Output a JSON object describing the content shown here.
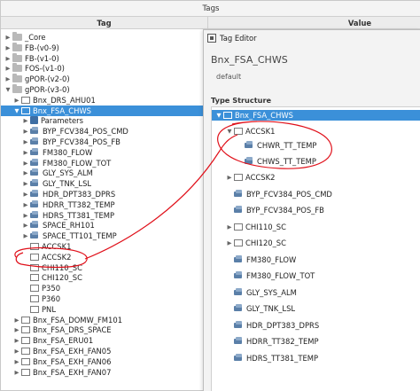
{
  "header": {
    "title": "Tags"
  },
  "columns": {
    "tag": "Tag",
    "value": "Value"
  },
  "tree": [
    {
      "label": "_Core",
      "icon": "folder",
      "arrow": "▶"
    },
    {
      "label": "FB-(v0-9)",
      "icon": "folder",
      "arrow": "▶"
    },
    {
      "label": "FB-(v1-0)",
      "icon": "folder",
      "arrow": "▶"
    },
    {
      "label": "FOS-(v1-0)",
      "icon": "folder",
      "arrow": "▶"
    },
    {
      "label": "gPOR-(v2-0)",
      "icon": "folder",
      "arrow": "▶"
    },
    {
      "label": "gPOR-(v3-0)",
      "icon": "folder",
      "arrow": "▼"
    },
    {
      "label": "Bnx_DRS_AHU01",
      "icon": "udt",
      "arrow": "▶"
    },
    {
      "label": "Bnx_FSA_CHWS",
      "icon": "udt",
      "arrow": "▼",
      "selected": true
    },
    {
      "label": "Parameters",
      "icon": "param",
      "arrow": "▶"
    },
    {
      "label": "BYP_FCV384_POS_CMD",
      "icon": "tag",
      "arrow": "▶"
    },
    {
      "label": "BYP_FCV384_POS_FB",
      "icon": "tag",
      "arrow": "▶"
    },
    {
      "label": "FM380_FLOW",
      "icon": "tag",
      "arrow": "▶"
    },
    {
      "label": "FM380_FLOW_TOT",
      "icon": "tag",
      "arrow": "▶"
    },
    {
      "label": "GLY_SYS_ALM",
      "icon": "tag",
      "arrow": "▶"
    },
    {
      "label": "GLY_TNK_LSL",
      "icon": "tag",
      "arrow": "▶"
    },
    {
      "label": "HDR_DPT383_DPRS",
      "icon": "tag",
      "arrow": "▶"
    },
    {
      "label": "HDRR_TT382_TEMP",
      "icon": "tag",
      "arrow": "▶"
    },
    {
      "label": "HDRS_TT381_TEMP",
      "icon": "tag",
      "arrow": "▶"
    },
    {
      "label": "SPACE_RH101",
      "icon": "tag",
      "arrow": "▶"
    },
    {
      "label": "SPACE_TT101_TEMP",
      "icon": "tag",
      "arrow": "▶"
    },
    {
      "label": "ACCSK1",
      "icon": "udt",
      "arrow": ""
    },
    {
      "label": "ACCSK2",
      "icon": "udt",
      "arrow": ""
    },
    {
      "label": "CHI110_SC",
      "icon": "udt",
      "arrow": ""
    },
    {
      "label": "CHI120_SC",
      "icon": "udt",
      "arrow": ""
    },
    {
      "label": "P350",
      "icon": "udt",
      "arrow": ""
    },
    {
      "label": "P360",
      "icon": "udt",
      "arrow": ""
    },
    {
      "label": "PNL",
      "icon": "udt",
      "arrow": ""
    },
    {
      "label": "Bnx_FSA_DOMW_FM101",
      "icon": "udt",
      "arrow": "▶"
    },
    {
      "label": "Bnx_FSA_DRS_SPACE",
      "icon": "udt",
      "arrow": "▶"
    },
    {
      "label": "Bnx_FSA_ERU01",
      "icon": "udt",
      "arrow": "▶"
    },
    {
      "label": "Bnx_FSA_EXH_FAN05",
      "icon": "udt",
      "arrow": "▶"
    },
    {
      "label": "Bnx_FSA_EXH_FAN06",
      "icon": "udt",
      "arrow": "▶"
    },
    {
      "label": "Bnx_FSA_EXH_FAN07",
      "icon": "udt",
      "arrow": "▶"
    }
  ],
  "editor": {
    "title": "Tag Editor",
    "name": "Bnx_FSA_CHWS",
    "subtitle": "default",
    "type_structure_label": "Type Structure",
    "tree": [
      {
        "label": "Bnx_FSA_CHWS",
        "icon": "udt",
        "arrow": "▼",
        "selected": true
      },
      {
        "label": "ACCSK1",
        "icon": "udt",
        "arrow": "▼"
      },
      {
        "label": "CHWR_TT_TEMP",
        "icon": "tag",
        "arrow": ""
      },
      {
        "label": "CHWS_TT_TEMP",
        "icon": "tag",
        "arrow": ""
      },
      {
        "label": "ACCSK2",
        "icon": "udt",
        "arrow": "▶"
      },
      {
        "label": "BYP_FCV384_POS_CMD",
        "icon": "tag",
        "arrow": ""
      },
      {
        "label": "BYP_FCV384_POS_FB",
        "icon": "tag",
        "arrow": ""
      },
      {
        "label": "CHI110_SC",
        "icon": "udt",
        "arrow": "▶"
      },
      {
        "label": "CHI120_SC",
        "icon": "udt",
        "arrow": "▶"
      },
      {
        "label": "FM380_FLOW",
        "icon": "tag",
        "arrow": ""
      },
      {
        "label": "FM380_FLOW_TOT",
        "icon": "tag",
        "arrow": ""
      },
      {
        "label": "GLY_SYS_ALM",
        "icon": "tag",
        "arrow": ""
      },
      {
        "label": "GLY_TNK_LSL",
        "icon": "tag",
        "arrow": ""
      },
      {
        "label": "HDR_DPT383_DPRS",
        "icon": "tag",
        "arrow": ""
      },
      {
        "label": "HDRR_TT382_TEMP",
        "icon": "tag",
        "arrow": ""
      },
      {
        "label": "HDRS_TT381_TEMP",
        "icon": "tag",
        "arrow": ""
      }
    ]
  },
  "colors": {
    "selection": "#3b90d9",
    "annotation": "#e0101a"
  }
}
